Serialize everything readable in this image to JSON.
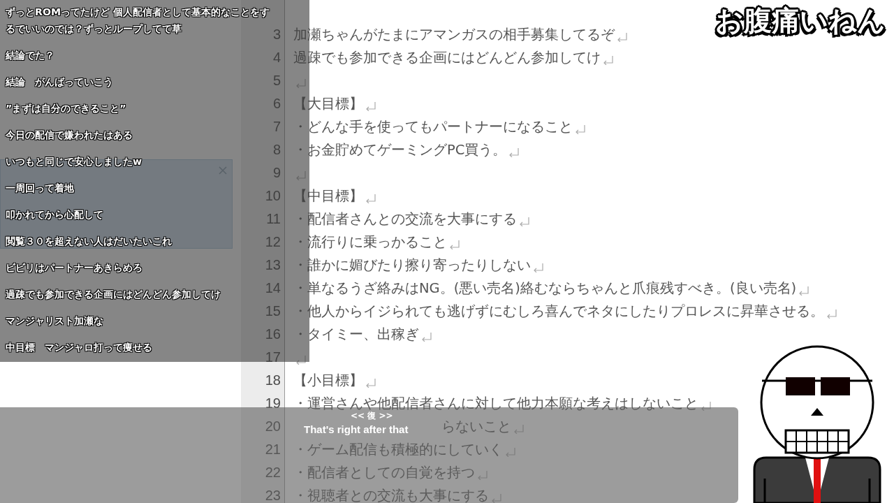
{
  "caption": "お腹痛いねん",
  "editor": {
    "lines": [
      {
        "number": "3",
        "text": "加瀬ちゃんがたまにアマンガスの相手募集してるぞ",
        "return_mark": true
      },
      {
        "number": "4",
        "text": "過疎でも参加できる企画にはどんどん参加してけ",
        "return_mark": true
      },
      {
        "number": "5",
        "return_mark": true
      },
      {
        "number": "6",
        "text": "【大目標】",
        "return_mark": true
      },
      {
        "number": "7",
        "text": "・どんな手を使ってもパートナーになること",
        "return_mark": true
      },
      {
        "number": "8",
        "text": "・お金貯めてゲーミングPC買う。",
        "return_mark": true
      },
      {
        "number": "9",
        "return_mark": true
      },
      {
        "number": "10",
        "text": "【中目標】",
        "return_mark": true
      },
      {
        "number": "11",
        "text": "・配信者さんとの交流を大事にする",
        "return_mark": true
      },
      {
        "number": "12",
        "text": "・流行りに乗っかること",
        "return_mark": true
      },
      {
        "number": "13",
        "text": "・誰かに媚びたり擦り寄ったりしない",
        "return_mark": true
      },
      {
        "number": "14",
        "text": "・単なるうざ絡みはNG。(悪い売名)絡むならちゃんと爪痕残すべき。(良い売名)",
        "return_mark": true
      },
      {
        "number": "15",
        "text": "・他人からイジられても逃げずにむしろ喜んでネタにしたりプロレスに昇華させる。",
        "return_mark": true
      },
      {
        "number": "16",
        "text": "・タイミー、出稼ぎ",
        "return_mark": true
      },
      {
        "number": "17",
        "return_mark": true
      },
      {
        "number": "18",
        "text": "【小目標】",
        "return_mark": true
      },
      {
        "number": "19",
        "text": "・運営さんや他配信者さんに対して他力本願な考えはしないこと",
        "return_mark": true
      },
      {
        "number": "20",
        "text": "らないこと",
        "covered": true,
        "return_mark": true
      },
      {
        "number": "21",
        "text": "・ゲーム配信も積極的にしていく",
        "return_mark": true
      },
      {
        "number": "22",
        "text": "・配信者としての自覚を持つ",
        "return_mark": true
      },
      {
        "number": "23",
        "text": "・視聴者との交流も大事にする",
        "return_mark": true
      }
    ]
  },
  "chat": {
    "messages": [
      "ずっとROMってたけど 個人配信者として基本的なことをするでいいのでは？ずっとループしてて草",
      "結論でた？",
      "結論　がんばっていこう",
      "”まずは自分のできること”",
      "今日の配信で嫌われたはある",
      "いつもと同じで安心しましたw",
      "一周回って着地",
      "叩かれてから心配して",
      "閲覧３０を超えない人はだいたいこれ",
      "ビビリはパートナーあきらめろ",
      "過疎でも参加できる企画にはどんどん参加してけ",
      "マンジャリスト加瀬な",
      "中目標　マンジャロ打って痩せる"
    ]
  },
  "subtitle": {
    "speaker": "<< 復 >>",
    "text": "That's right after that"
  }
}
